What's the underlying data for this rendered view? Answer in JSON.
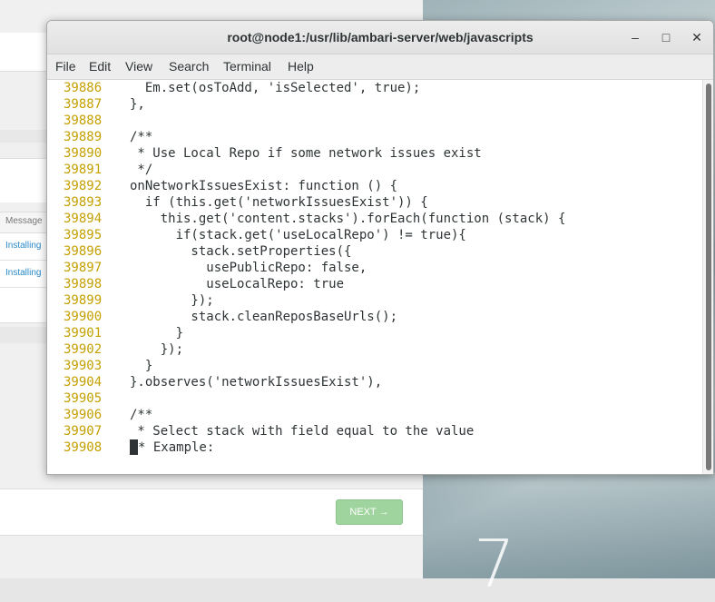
{
  "desktop": {
    "logo_text": "7"
  },
  "webpage": {
    "table_header": "Message",
    "rows": [
      "Installing",
      "Installing"
    ],
    "next_label": "NEXT →"
  },
  "terminal": {
    "title": "root@node1:/usr/lib/ambari-server/web/javascripts",
    "controls": {
      "minimize": "‒",
      "maximize": "□",
      "close": "✕"
    },
    "menu": [
      "File",
      "Edit",
      "View",
      "Search",
      "Terminal",
      "Help"
    ],
    "lines": [
      {
        "num": "39886",
        "text": "  Em.set(osToAdd, 'isSelected', true);"
      },
      {
        "num": "39887",
        "text": "},"
      },
      {
        "num": "39888",
        "text": ""
      },
      {
        "num": "39889",
        "text": "/**"
      },
      {
        "num": "39890",
        "text": " * Use Local Repo if some network issues exist"
      },
      {
        "num": "39891",
        "text": " */"
      },
      {
        "num": "39892",
        "text": "onNetworkIssuesExist: function () {"
      },
      {
        "num": "39893",
        "text": "  if (this.get('networkIssuesExist')) {"
      },
      {
        "num": "39894",
        "text": "    this.get('content.stacks').forEach(function (stack) {"
      },
      {
        "num": "39895",
        "text": "      if(stack.get('useLocalRepo') != true){"
      },
      {
        "num": "39896",
        "text": "        stack.setProperties({"
      },
      {
        "num": "39897",
        "text": "          usePublicRepo: false,"
      },
      {
        "num": "39898",
        "text": "          useLocalRepo: true"
      },
      {
        "num": "39899",
        "text": "        });"
      },
      {
        "num": "39900",
        "text": "        stack.cleanReposBaseUrls();"
      },
      {
        "num": "39901",
        "text": "      }"
      },
      {
        "num": "39902",
        "text": "    });"
      },
      {
        "num": "39903",
        "text": "  }"
      },
      {
        "num": "39904",
        "text": "}.observes('networkIssuesExist'),"
      },
      {
        "num": "39905",
        "text": ""
      },
      {
        "num": "39906",
        "text": "/**"
      },
      {
        "num": "39907",
        "text": " * Select stack with field equal to the value"
      },
      {
        "num": "39908",
        "text": "* Example:"
      }
    ]
  }
}
